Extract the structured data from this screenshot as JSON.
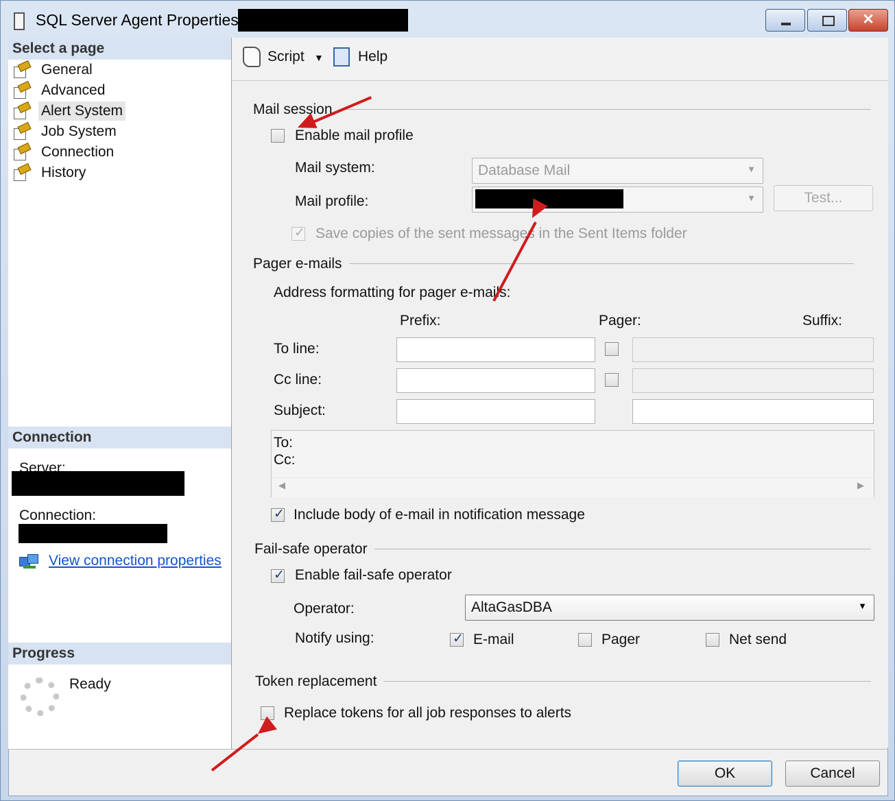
{
  "window": {
    "title": "SQL Server Agent Properties -"
  },
  "nav": {
    "header": "Select a page",
    "items": [
      {
        "label": "General"
      },
      {
        "label": "Advanced"
      },
      {
        "label": "Alert System"
      },
      {
        "label": "Job System"
      },
      {
        "label": "Connection"
      },
      {
        "label": "History"
      }
    ],
    "selected": "Alert System"
  },
  "connection": {
    "header": "Connection",
    "server_label": "Server:",
    "connection_label": "Connection:",
    "view_link": "View connection properties"
  },
  "progress": {
    "header": "Progress",
    "status": "Ready"
  },
  "toolbar": {
    "script_label": "Script",
    "help_label": "Help"
  },
  "mail_session": {
    "group_label": "Mail session",
    "enable_label": "Enable mail profile",
    "enable_checked": false,
    "mail_system_label": "Mail system:",
    "mail_system_value": "Database Mail",
    "mail_profile_label": "Mail profile:",
    "test_button": "Test...",
    "save_copies_label": "Save copies of the sent messages in the Sent Items folder",
    "save_copies_checked": true
  },
  "pager": {
    "group_label": "Pager e-mails",
    "address_label": "Address formatting for pager e-mails:",
    "prefix_header": "Prefix:",
    "pager_header": "Pager:",
    "suffix_header": "Suffix:",
    "to_line_label": "To line:",
    "cc_line_label": "Cc line:",
    "subject_label": "Subject:",
    "preview_to": "To:",
    "preview_cc": "Cc:",
    "include_body_label": "Include body of e-mail in notification message",
    "include_body_checked": true
  },
  "failsafe": {
    "group_label": "Fail-safe operator",
    "enable_label": "Enable fail-safe operator",
    "enable_checked": true,
    "operator_label": "Operator:",
    "operator_value": "AltaGasDBA",
    "notify_label": "Notify using:",
    "email_label": "E-mail",
    "email_checked": true,
    "pager_label": "Pager",
    "pager_checked": false,
    "netsend_label": "Net send",
    "netsend_checked": false
  },
  "token": {
    "group_label": "Token replacement",
    "replace_label": "Replace tokens for all job responses to alerts",
    "replace_checked": false
  },
  "footer": {
    "ok_label": "OK",
    "cancel_label": "Cancel"
  },
  "colors": {
    "annotation_arrow": "#d01c1c",
    "link": "#1155cc"
  }
}
